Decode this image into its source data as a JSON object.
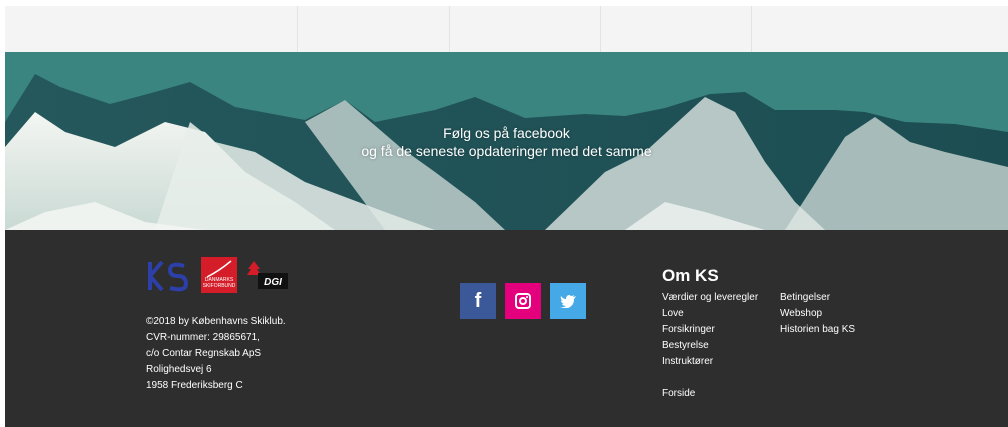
{
  "banner": {
    "line1": "Følg os på facebook",
    "line2": "og få de seneste opdateringer med det samme"
  },
  "footer": {
    "logos": {
      "ks": "KS",
      "dsf": "DANMARKS SKIFORBUND",
      "dgi": "DGI"
    },
    "address": [
      "©2018 by Københavns Skiklub.",
      "CVR-nummer: 29865671,",
      "c/o Contar Regnskab ApS",
      "Rolighedsvej 6",
      "1958 Frederiksberg C"
    ],
    "social": [
      {
        "name": "facebook",
        "glyph": "f",
        "color": "#3b5998"
      },
      {
        "name": "instagram",
        "color": "#e4007c"
      },
      {
        "name": "twitter",
        "color": "#45a8e7"
      }
    ],
    "about": {
      "title": "Om KS",
      "col1": [
        "Værdier og leveregler",
        "Love",
        "Forsikringer",
        "Bestyrelse",
        "Instruktører"
      ],
      "col2": [
        "Betingelser",
        "Webshop",
        "Historien bag KS"
      ],
      "forside": "Forside"
    }
  },
  "colors": {
    "footer_bg": "#2e2e2e",
    "topbar_bg": "#f4f4f4"
  }
}
